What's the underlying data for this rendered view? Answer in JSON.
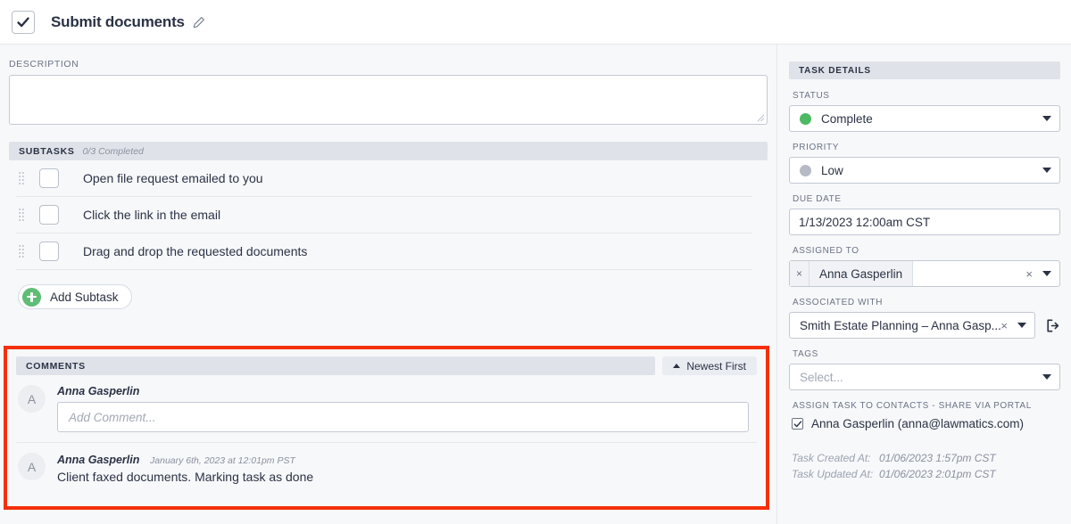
{
  "header": {
    "checkbox_checked": true,
    "title": "Submit documents",
    "edit_icon": "pencil-icon"
  },
  "description": {
    "label": "DESCRIPTION",
    "value": ""
  },
  "subtasks": {
    "section_label": "SUBTASKS",
    "progress": "0/3 Completed",
    "items": [
      {
        "label": "Open file request emailed to you",
        "checked": false
      },
      {
        "label": "Click the link in the email",
        "checked": false
      },
      {
        "label": "Drag and drop the requested documents",
        "checked": false
      }
    ],
    "add_button": "Add Subtask"
  },
  "comments": {
    "section_label": "COMMENTS",
    "sort_button": "Newest First",
    "sort_direction_icon": "caret-up-icon",
    "composer": {
      "avatar_initial": "A",
      "author": "Anna Gasperlin",
      "placeholder": "Add Comment...",
      "value": ""
    },
    "entries": [
      {
        "avatar_initial": "A",
        "author": "Anna Gasperlin",
        "timestamp": "January 6th, 2023 at 12:01pm PST",
        "text": "Client faxed documents. Marking task as done"
      }
    ],
    "highlight_color": "#f4300c"
  },
  "task_details": {
    "header": "TASK DETAILS",
    "status": {
      "label": "STATUS",
      "value": "Complete",
      "dot_color": "#4cb963"
    },
    "priority": {
      "label": "PRIORITY",
      "value": "Low",
      "dot_color": "#b5bac4"
    },
    "due_date": {
      "label": "DUE DATE",
      "value": "1/13/2023 12:00am CST"
    },
    "assigned_to": {
      "label": "ASSIGNED TO",
      "token": "Anna Gasperlin",
      "token_remove": "×",
      "clear": "×"
    },
    "associated_with": {
      "label": "ASSOCIATED WITH",
      "value": "Smith Estate Planning – Anna Gasp...",
      "clear": "×",
      "open_icon": "external-link-icon"
    },
    "tags": {
      "label": "TAGS",
      "placeholder": "Select..."
    },
    "portal": {
      "label": "ASSIGN TASK TO CONTACTS - SHARE VIA PORTAL",
      "contact": "Anna Gasperlin (anna@lawmatics.com)",
      "checked": true
    },
    "meta": {
      "created_label": "Task Created At:",
      "created_value": "01/06/2023 1:57pm CST",
      "updated_label": "Task Updated At:",
      "updated_value": "01/06/2023 2:01pm CST"
    }
  }
}
